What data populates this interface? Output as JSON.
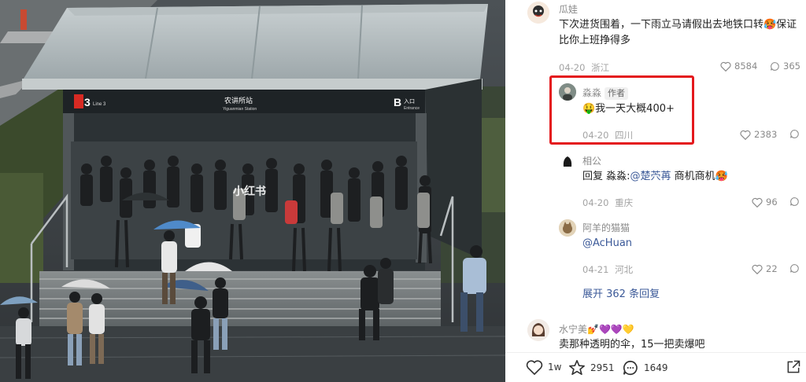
{
  "photo": {
    "station_line": "3",
    "station_line_sub": "Line 3",
    "station_name": "农讲所站",
    "station_name_en": "Yiguanmian Station",
    "exit_letter": "B",
    "exit_label": "入口",
    "exit_label_en": "Entrance",
    "watermark": "小红书"
  },
  "comments": [
    {
      "username": "瓜娃",
      "text": "下次进货围着，一下雨立马请假出去地铁口转🥵保证比你上班挣得多",
      "date": "04-20",
      "location": "浙江",
      "likes": "8584",
      "replies": "365"
    },
    {
      "username": "淼淼",
      "author_tag": "作者",
      "text": "🤑我一天大概400+",
      "date": "04-20",
      "location": "四川",
      "likes": "2383"
    },
    {
      "username": "相公",
      "reply_prefix": "回复 淼淼:",
      "mention": "@楚茓苒",
      "text_suffix": "商机商机🥵",
      "date": "04-20",
      "location": "重庆",
      "likes": "96"
    },
    {
      "username": "阿羊的猫猫",
      "mention": "@AcHuan",
      "date": "04-21",
      "location": "河北",
      "likes": "22"
    },
    {
      "username": "水宁美💅💜💜💛",
      "text": "卖那种透明的伞，15一把卖爆吧"
    }
  ],
  "expand_replies": "展开 362 条回复",
  "bottom_bar": {
    "likes": "1w",
    "stars": "2951",
    "comments": "1649"
  },
  "colors": {
    "highlight": "#e4181c",
    "mention": "#3b5998"
  }
}
